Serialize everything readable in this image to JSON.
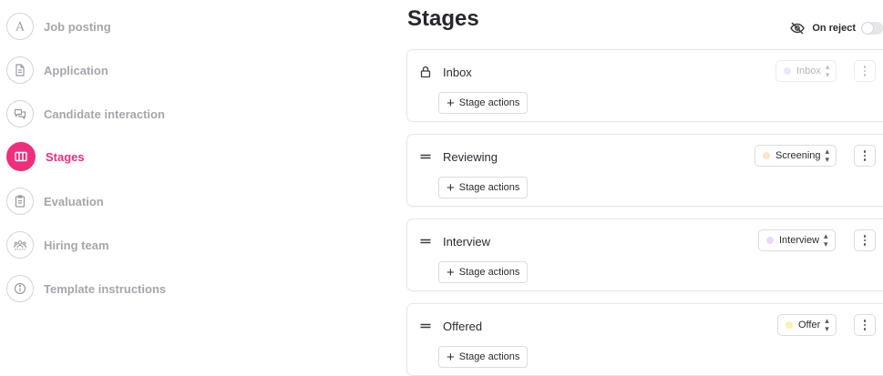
{
  "sidebar": {
    "items": [
      {
        "label": "Job posting",
        "icon": "letter-a-icon",
        "active": false
      },
      {
        "label": "Application",
        "icon": "document-icon",
        "active": false
      },
      {
        "label": "Candidate interaction",
        "icon": "chat-bubbles-icon",
        "active": false
      },
      {
        "label": "Stages",
        "icon": "columns-icon",
        "active": true
      },
      {
        "label": "Evaluation",
        "icon": "clipboard-icon",
        "active": false
      },
      {
        "label": "Hiring team",
        "icon": "team-icon",
        "active": false
      },
      {
        "label": "Template instructions",
        "icon": "info-icon",
        "active": false
      }
    ]
  },
  "main": {
    "title": "Stages",
    "on_reject": {
      "label": "On reject",
      "icon": "eye-off-icon",
      "enabled": false
    },
    "stage_actions_label": "Stage actions",
    "stages": [
      {
        "name": "Inbox",
        "icon": "lock-icon",
        "status": "Inbox",
        "status_color": "#ebe6fb",
        "locked": true
      },
      {
        "name": "Reviewing",
        "icon": "drag-handle-icon",
        "status": "Screening",
        "status_color": "#fde4cc",
        "locked": false
      },
      {
        "name": "Interview",
        "icon": "drag-handle-icon",
        "status": "Interview",
        "status_color": "#ead9fb",
        "locked": false
      },
      {
        "name": "Offered",
        "icon": "drag-handle-icon",
        "status": "Offer",
        "status_color": "#fbf1b8",
        "locked": false
      }
    ]
  },
  "colors": {
    "accent": "#ee2f7b"
  }
}
